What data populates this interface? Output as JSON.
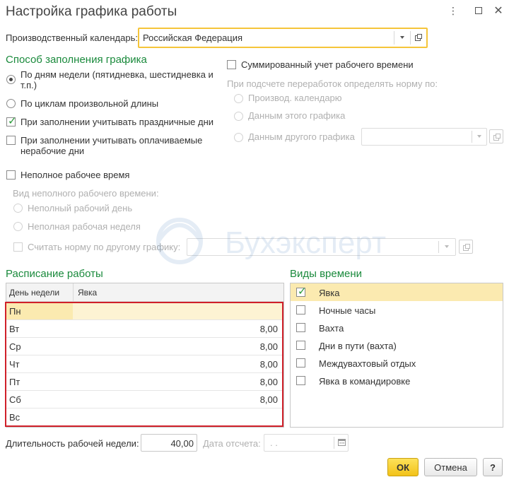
{
  "window": {
    "title": "Настройка графика работы",
    "menu_icon": "more-icon",
    "maximize_icon": "maximize-icon",
    "close_icon": "close-icon"
  },
  "calendar": {
    "label": "Производственный календарь:",
    "value": "Российская Федерация"
  },
  "fill_method": {
    "title": "Способ заполнения графика",
    "by_weekdays": "По дням недели (пятидневка, шестидневка и т.п.)",
    "by_cycles": "По циклам произвольной длины",
    "holidays": "При заполнении учитывать праздничные дни",
    "paid_nonworking": "При заполнении учитывать оплачиваемые нерабочие дни",
    "part_time": "Неполное рабочее время",
    "part_time_kind_label": "Вид неполного рабочего времени:",
    "part_time_day": "Неполный рабочий день",
    "part_time_week": "Неполная рабочая неделя",
    "norm_other_schedule": "Считать норму по другому графику:"
  },
  "summary": {
    "summed_accounting": "Суммированный учет рабочего времени",
    "norm_label": "При подсчете переработок определять норму по:",
    "by_calendar": "Производ. календарю",
    "by_this_schedule": "Данным этого графика",
    "by_other_schedule": "Данным другого графика"
  },
  "schedule": {
    "title": "Расписание работы",
    "col_day": "День недели",
    "col_attendance": "Явка",
    "rows": [
      {
        "day": "Пн",
        "value": ""
      },
      {
        "day": "Вт",
        "value": "8,00"
      },
      {
        "day": "Ср",
        "value": "8,00"
      },
      {
        "day": "Чт",
        "value": "8,00"
      },
      {
        "day": "Пт",
        "value": "8,00"
      },
      {
        "day": "Сб",
        "value": "8,00"
      },
      {
        "day": "Вс",
        "value": ""
      }
    ]
  },
  "time_types": {
    "title": "Виды времени",
    "items": [
      {
        "label": "Явка",
        "checked": true
      },
      {
        "label": "Ночные часы",
        "checked": false
      },
      {
        "label": "Вахта",
        "checked": false
      },
      {
        "label": "Дни в пути (вахта)",
        "checked": false
      },
      {
        "label": "Междувахтовый отдых",
        "checked": false
      },
      {
        "label": "Явка в командировке",
        "checked": false
      }
    ]
  },
  "footer": {
    "week_length_label": "Длительность рабочей недели:",
    "week_length_value": "40,00",
    "ref_date_label": "Дата отсчета:",
    "ref_date_placeholder": " .  .",
    "ok": "ОК",
    "cancel": "Отмена",
    "help": "?"
  },
  "watermark": {
    "text": "Бухэксперт"
  },
  "colors": {
    "accent_green": "#1a8a3c",
    "focus_yellow": "#f5c53a",
    "highlight_red": "#d0202a",
    "selected_row": "#fbeab0"
  }
}
